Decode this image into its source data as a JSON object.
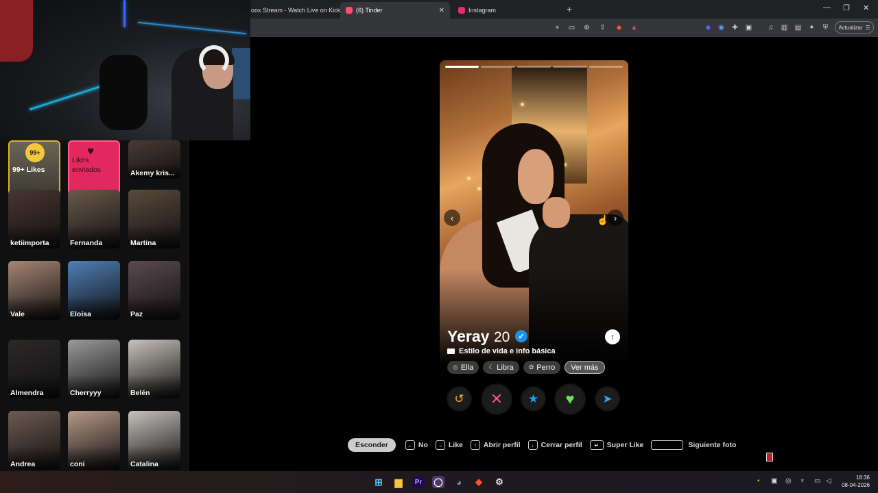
{
  "browser": {
    "tabs": [
      {
        "title": "oox Stream - Watch Live on Kick",
        "active": false,
        "color": "#53fc18"
      },
      {
        "title": "(6) Tinder",
        "active": true,
        "color": "#fd4d6b"
      },
      {
        "title": "Instagram",
        "active": false,
        "color": "#e1306c"
      }
    ],
    "new_tab": "+",
    "window_controls": {
      "minimize": "—",
      "maximize": "❐",
      "close": "✕"
    },
    "update_label": "Actualizar"
  },
  "sidebar": {
    "likes_badge": "99+",
    "likes_label": "99+ Likes",
    "sent_label": "Likes enviados",
    "matches": [
      {
        "name": "Akemy kris...",
        "color": "#4b3a33"
      },
      {
        "name": "ketiimporta",
        "color": "#4a3532"
      },
      {
        "name": "Fernanda",
        "color": "#6b5a4b"
      },
      {
        "name": "Martina",
        "color": "#5b4a3c"
      },
      {
        "name": "Vale",
        "color": "#a78675"
      },
      {
        "name": "Eloísa",
        "color": "#4f7fb8"
      },
      {
        "name": "Paz",
        "color": "#5b4a4f"
      },
      {
        "name": "Almendra",
        "color": "#2c2828"
      },
      {
        "name": "Cherryyy",
        "color": "#9a9a9a"
      },
      {
        "name": "Belén",
        "color": "#c8c2ba"
      },
      {
        "name": "Andrea",
        "color": "#6e5a52"
      },
      {
        "name": "coni",
        "color": "#b89a88"
      },
      {
        "name": "Catalina",
        "color": "#c7c2bd"
      }
    ]
  },
  "profile": {
    "name": "Yeray",
    "age": "20",
    "verified_icon": "✓",
    "section_label": "Estilo de vida e info básica",
    "chips": [
      {
        "label": "Ella",
        "icon": "person-icon",
        "glyph": "◎"
      },
      {
        "label": "Libra",
        "icon": "moon-icon",
        "glyph": "☾"
      },
      {
        "label": "Perro",
        "icon": "paw-icon",
        "glyph": "✿"
      }
    ],
    "more_label": "Ver más",
    "photo_count": 5,
    "current_photo": 1,
    "actions": [
      {
        "name": "rewind-button",
        "glyph": "↺",
        "color": "#f5b32b"
      },
      {
        "name": "nope-button",
        "glyph": "✕",
        "color": "#ff4d8a"
      },
      {
        "name": "super-like-button",
        "glyph": "★",
        "color": "#1ea1f2"
      },
      {
        "name": "like-button",
        "glyph": "♥",
        "color": "#6fe05a"
      },
      {
        "name": "boost-button",
        "glyph": "➤",
        "color": "#2fa8e8"
      }
    ]
  },
  "hints": {
    "hide_label": "Esconder",
    "items": [
      {
        "key": "←",
        "label": "No"
      },
      {
        "key": "→",
        "label": "Like"
      },
      {
        "key": "↑",
        "label": "Abrir perfil"
      },
      {
        "key": "↓",
        "label": "Cerrar perfil"
      },
      {
        "key": "↵",
        "label": "Super Like"
      },
      {
        "key": "",
        "label": "Siguiente foto"
      }
    ]
  },
  "taskbar": {
    "time": "18:36",
    "date": "08-04-2026"
  }
}
